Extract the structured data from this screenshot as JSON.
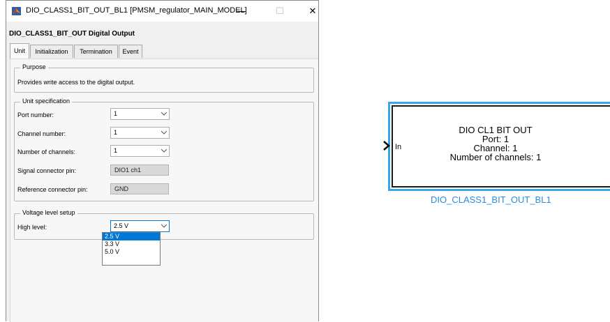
{
  "window": {
    "title": "DIO_CLASS1_BIT_OUT_BL1  [PMSM_regulator_MAIN_MODEL]",
    "minimize_label": "—",
    "maximize_label": "☐",
    "close_label": "✕"
  },
  "block_heading": "DIO_CLASS1_BIT_OUT  Digital Output",
  "tabs": [
    {
      "label": "Unit",
      "active": true
    },
    {
      "label": "Initialization",
      "active": false
    },
    {
      "label": "Termination",
      "active": false
    },
    {
      "label": "Event",
      "active": false
    }
  ],
  "purpose": {
    "legend": "Purpose",
    "text": "Provides write access to the digital output."
  },
  "unit_spec": {
    "legend": "Unit specification",
    "port_number_label": "Port number:",
    "port_number_value": "1",
    "channel_number_label": "Channel number:",
    "channel_number_value": "1",
    "num_channels_label": "Number of channels:",
    "num_channels_value": "1",
    "signal_pin_label": "Signal connector pin:",
    "signal_pin_value": "DIO1 ch1",
    "ref_pin_label": "Reference connector pin:",
    "ref_pin_value": "GND"
  },
  "voltage": {
    "legend": "Voltage level setup",
    "high_level_label": "High level:",
    "high_level_value": "2.5 V",
    "options": [
      "2.5 V",
      "3.3 V",
      "5.0 V"
    ]
  },
  "simulink_block": {
    "input_label": "In",
    "line1": "DIO CL1 BIT OUT",
    "line2": "Port: 1",
    "line3": "Channel: 1",
    "line4": "Number of channels: 1",
    "caption": "DIO_CLASS1_BIT_OUT_BL1"
  },
  "colors": {
    "selection": "#0078d7",
    "block_highlight": "#37a7ea",
    "caption": "#2a8be0"
  }
}
